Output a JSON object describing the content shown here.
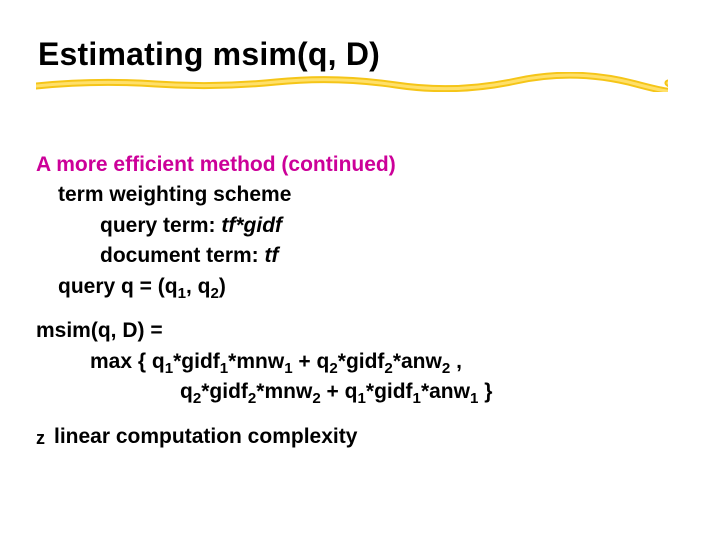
{
  "title": "Estimating msim(q, D)",
  "heading": "A more efficient method (continued)",
  "tws_label": "term weighting scheme",
  "qt_label": "query term:  ",
  "qt_formula": "tf*gidf",
  "dt_label": "document term: ",
  "dt_formula": "tf",
  "query_prefix": "query q = (q",
  "query_mid": ", q",
  "query_suffix": ")",
  "msim_lhs": "msim(q, D) =",
  "max_open": "max { q",
  "g": "*gidf",
  "m": "*mnw",
  "a": "*anw",
  "plus": " + q",
  "comma": " ,",
  "line2_lead": "q",
  "close": " }",
  "s1": "1",
  "s2": "2",
  "bullet_text": "linear computation complexity",
  "bullet_glyph": "z"
}
